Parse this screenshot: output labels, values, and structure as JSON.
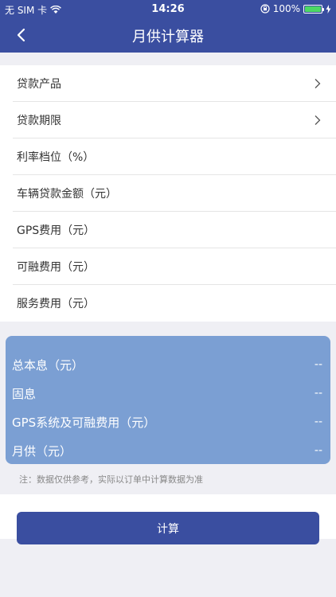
{
  "status_bar": {
    "carrier": "无 SIM 卡",
    "time": "14:26",
    "battery": "100%",
    "battery_level": 1.0,
    "icons": [
      "wifi-icon",
      "orientation-lock-icon",
      "battery-icon",
      "charging-icon"
    ]
  },
  "nav": {
    "title": "月供计算器",
    "back_icon": "chevron-left-icon"
  },
  "form": {
    "rows": [
      {
        "label": "贷款产品",
        "has_chevron": true
      },
      {
        "label": "贷款期限",
        "has_chevron": true
      },
      {
        "label": "利率档位（%）",
        "has_chevron": false
      },
      {
        "label": "车辆贷款金额（元）",
        "has_chevron": false
      },
      {
        "label": "GPS费用（元）",
        "has_chevron": false
      },
      {
        "label": "可融费用（元）",
        "has_chevron": false
      },
      {
        "label": "服务费用（元）",
        "has_chevron": false
      }
    ]
  },
  "summary": {
    "rows": [
      {
        "label": "总本息（元）",
        "value": "--"
      },
      {
        "label": "固息",
        "value": "--"
      },
      {
        "label": "GPS系统及可融费用（元）",
        "value": "--"
      },
      {
        "label": "月供（元）",
        "value": "--"
      }
    ]
  },
  "note": "注：数据仅供参考，实际以订单中计算数据为准",
  "calculate_button": "计算",
  "colors": {
    "primary": "#3a4ea0",
    "summary_bg": "#7b9fd3",
    "page_bg": "#efeff4",
    "battery": "#4cd964"
  }
}
